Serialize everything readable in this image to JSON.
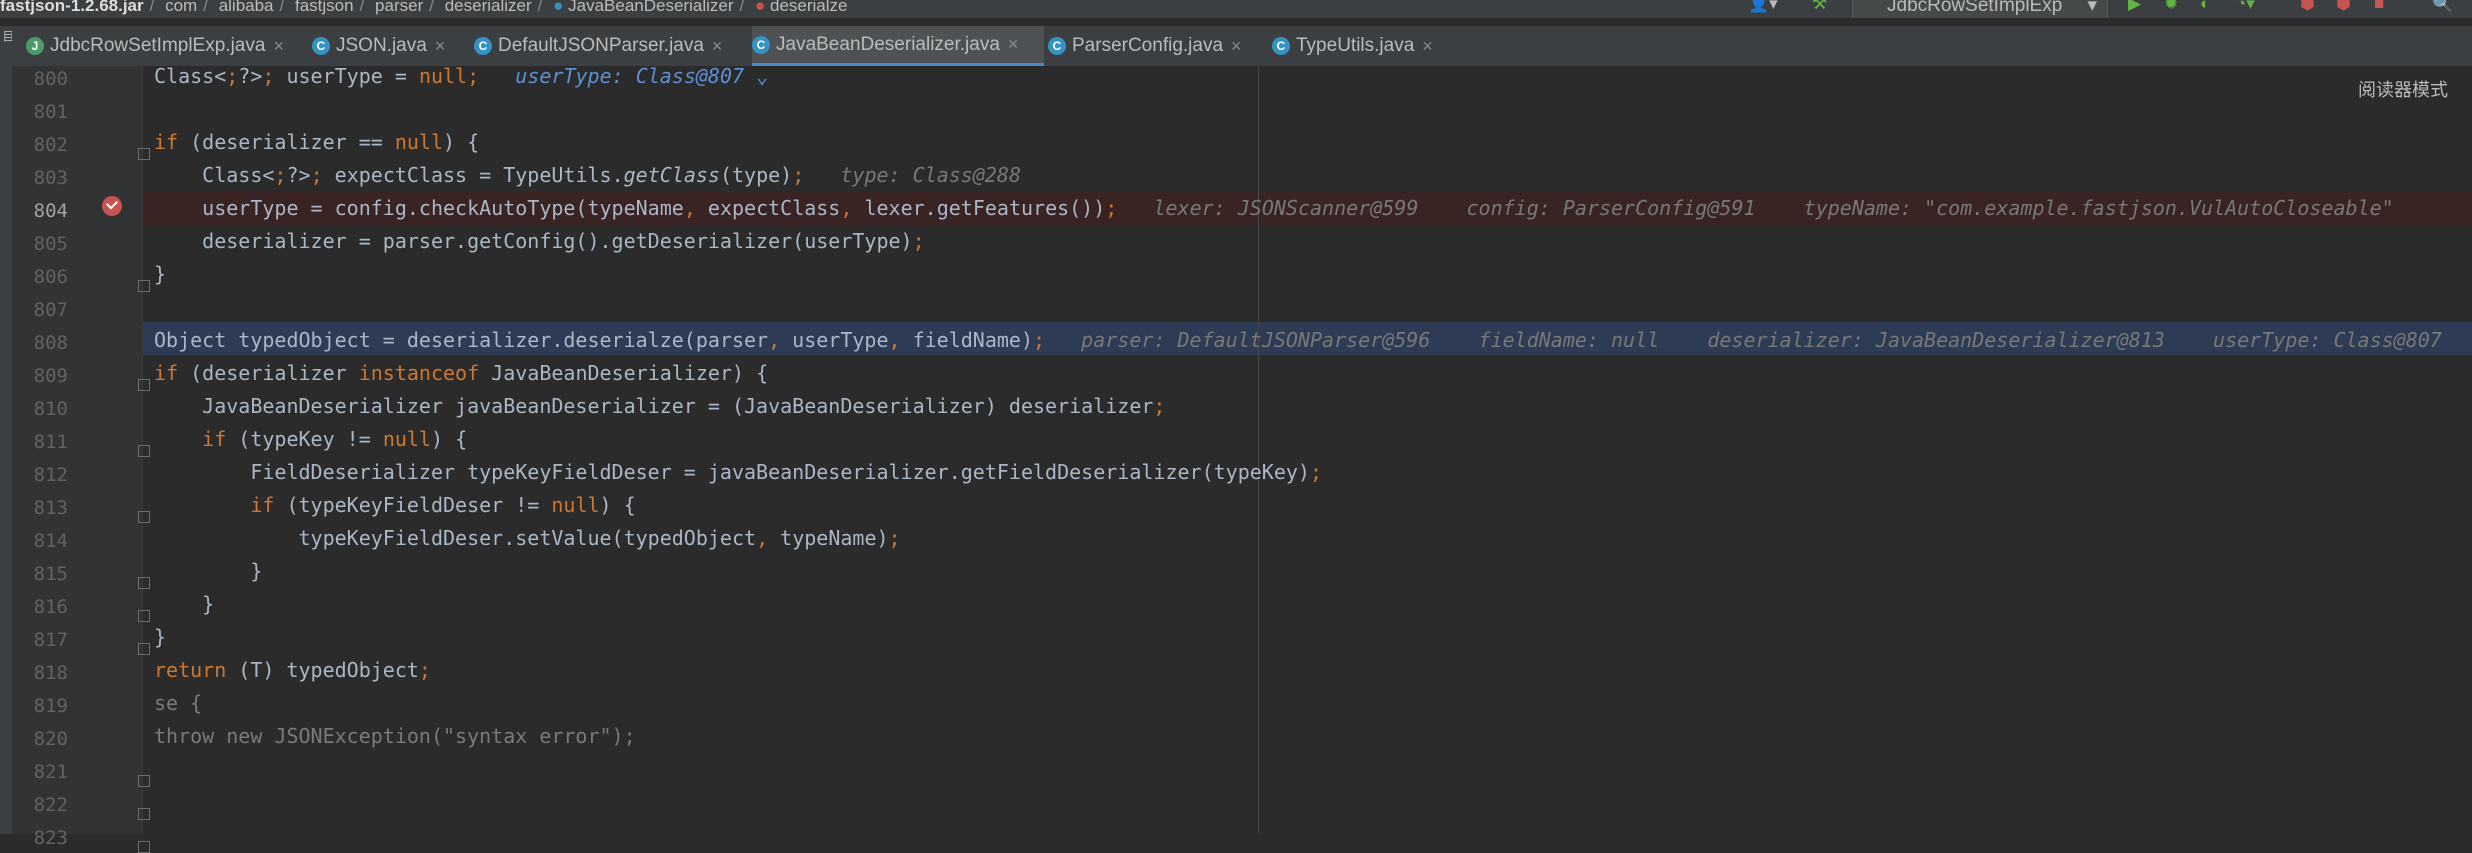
{
  "breadcrumb": {
    "items": [
      "fastjson-1.2.68.jar",
      "com",
      "alibaba",
      "fastjson",
      "parser",
      "deserializer",
      "JavaBeanDeserializer",
      "deserialze"
    ]
  },
  "toolbar": {
    "run_config": "JdbcRowSetImplExp"
  },
  "tabs": [
    {
      "label": "JdbcRowSetImplExp.java",
      "icon": "J",
      "active": false
    },
    {
      "label": "JSON.java",
      "icon": "C",
      "active": false
    },
    {
      "label": "DefaultJSONParser.java",
      "icon": "C",
      "active": false
    },
    {
      "label": "JavaBeanDeserializer.java",
      "icon": "C",
      "active": true
    },
    {
      "label": "ParserConfig.java",
      "icon": "C",
      "active": false
    },
    {
      "label": "TypeUtils.java",
      "icon": "C",
      "active": false
    }
  ],
  "reader_mode": "阅读器模式",
  "lines": [
    {
      "num": "800",
      "text": "Class<?> userType = null;",
      "hint": "userType: Class@807"
    },
    {
      "num": "801",
      "text": "",
      "hint": ""
    },
    {
      "num": "802",
      "text": "if (deserializer == null) {",
      "hint": ""
    },
    {
      "num": "803",
      "text": "    Class<?> expectClass = TypeUtils.getClass(type);",
      "hint": "type: Class@288"
    },
    {
      "num": "804",
      "text": "    userType = config.checkAutoType(typeName, expectClass, lexer.getFeatures());",
      "hint": "lexer: JSONScanner@599    config: ParserConfig@591    typeName: \"com.example.fastjson.VulAutoCloseable\""
    },
    {
      "num": "805",
      "text": "    deserializer = parser.getConfig().getDeserializer(userType);",
      "hint": ""
    },
    {
      "num": "806",
      "text": "}",
      "hint": ""
    },
    {
      "num": "807",
      "text": "",
      "hint": ""
    },
    {
      "num": "808",
      "text": "Object typedObject = deserializer.deserialze(parser, userType, fieldName);",
      "hint": "parser: DefaultJSONParser@596    fieldName: null    deserializer: JavaBeanDeserializer@813    userType: Class@807"
    },
    {
      "num": "809",
      "text": "if (deserializer instanceof JavaBeanDeserializer) {",
      "hint": ""
    },
    {
      "num": "810",
      "text": "    JavaBeanDeserializer javaBeanDeserializer = (JavaBeanDeserializer) deserializer;",
      "hint": ""
    },
    {
      "num": "811",
      "text": "    if (typeKey != null) {",
      "hint": ""
    },
    {
      "num": "812",
      "text": "        FieldDeserializer typeKeyFieldDeser = javaBeanDeserializer.getFieldDeserializer(typeKey);",
      "hint": ""
    },
    {
      "num": "813",
      "text": "        if (typeKeyFieldDeser != null) {",
      "hint": ""
    },
    {
      "num": "814",
      "text": "            typeKeyFieldDeser.setValue(typedObject, typeName);",
      "hint": ""
    },
    {
      "num": "815",
      "text": "        }",
      "hint": ""
    },
    {
      "num": "816",
      "text": "    }",
      "hint": ""
    },
    {
      "num": "817",
      "text": "}",
      "hint": ""
    },
    {
      "num": "818",
      "text": "return (T) typedObject;",
      "hint": ""
    },
    {
      "num": "819",
      "text": "se {",
      "hint": ""
    },
    {
      "num": "820",
      "text": "throw new JSONException(\"syntax error\");",
      "hint": ""
    },
    {
      "num": "821",
      "text": "",
      "hint": ""
    },
    {
      "num": "822",
      "text": "",
      "hint": ""
    },
    {
      "num": "823",
      "text": "",
      "hint": ""
    }
  ],
  "colors": {
    "background": "#2b2b2b",
    "keyword": "#cc7832",
    "breakpoint_line": "#3a2323",
    "execution_line": "#2d3c54",
    "tab_underline": "#4a88c7"
  }
}
